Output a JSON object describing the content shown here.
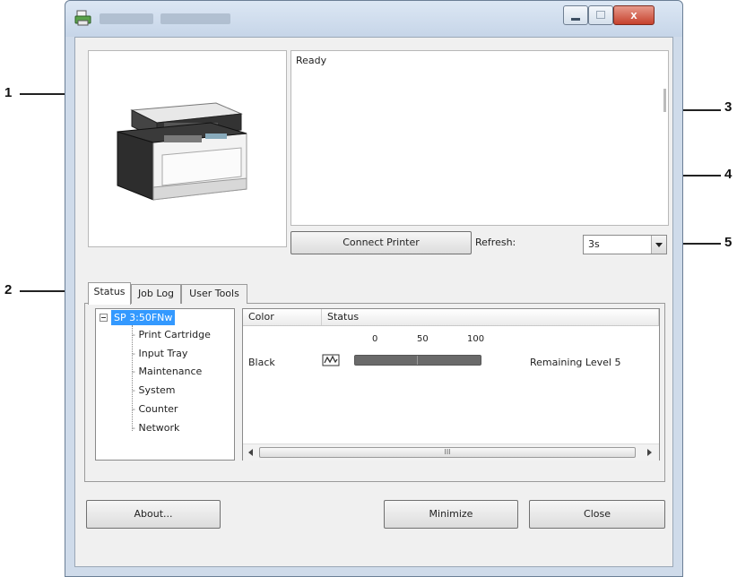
{
  "window": {
    "status_text": "Ready",
    "close_glyph": "x"
  },
  "callouts": [
    "1",
    "2",
    "3",
    "4",
    "5"
  ],
  "controls": {
    "connect_button": "Connect Printer",
    "refresh_label": "Refresh:",
    "refresh_value": "3s"
  },
  "tabs": [
    {
      "label": "Status",
      "active": true
    },
    {
      "label": "Job Log",
      "active": false
    },
    {
      "label": "User Tools",
      "active": false
    }
  ],
  "tree": {
    "root": "SP 3:50FNw",
    "children": [
      "Print Cartridge",
      "Input Tray",
      "Maintenance",
      "System",
      "Counter",
      "Network"
    ]
  },
  "table": {
    "headers": [
      "Color",
      "Status"
    ],
    "scale": [
      "0",
      "50",
      "100"
    ],
    "rows": [
      {
        "color": "Black",
        "remaining": "Remaining Level 5",
        "level_fraction": 1.0
      }
    ]
  },
  "scrollbar": {
    "thumb_glyph": "III"
  },
  "buttons": {
    "about": "About...",
    "minimize": "Minimize",
    "close": "Close"
  },
  "colors": {
    "selection": "#3399ff",
    "toner_bar": "#6a6a6a",
    "window_frame": "#cfdbea",
    "close_button": "#c6412c"
  }
}
